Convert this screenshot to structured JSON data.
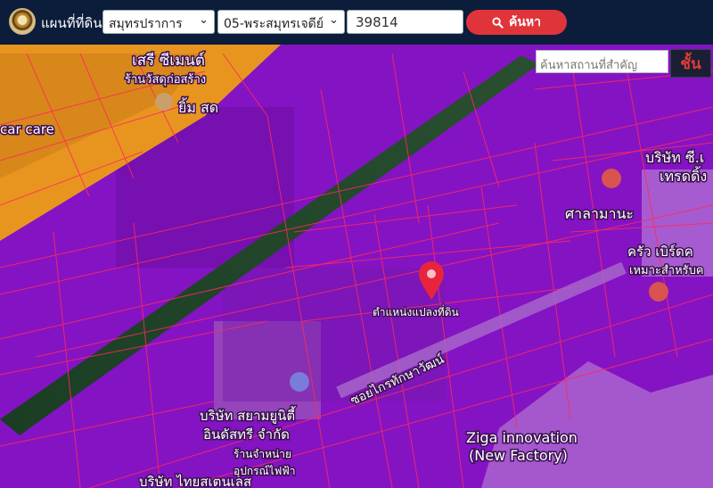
{
  "header": {
    "brand": "แผนที่ที่ดิน",
    "province_select": "สมุทรปราการ",
    "district_select": "05-พระสมุทรเจดีย์",
    "parcel_number": "39814",
    "search_button": "ค้นหา"
  },
  "map": {
    "place_search_placeholder": "ค้นหาสถานที่สำคัญ",
    "layer_button": "ชั้น",
    "marker_label": "ตำแหน่งแปลงที่ดิน",
    "labels": {
      "shop_top": "เสรี ซีเมนต์",
      "shop_top_sub": "ร้านวัสดุก่อสร้าง",
      "car_care": "car care",
      "yim_sod": "ยิ้ม สด",
      "company_tr": "บริษัท ซี.เ",
      "company_tr_sub": "เทรดดิ้ง",
      "sala": "ศาลามานะ",
      "krua": "ครัว เบิร์ดค",
      "krua_sub": "เหมาะสำหรับค",
      "road": "ซอยไกรทักษาวัฒน์",
      "siam_company": "บริษัท สยามยูนิตี้",
      "siam_company2": "อินดัสทรี จำกัด",
      "siam_sub1": "ร้านจำหน่าย",
      "siam_sub2": "อุปกรณ์ไฟฟ้า",
      "ziga": "Ziga innovation",
      "ziga2": "(New Factory)",
      "bottom_company": "บริษัท ไทยสเตนเลส"
    },
    "colors": {
      "zone_purple": "#8a14c8",
      "zone_orange": "#e8951e",
      "parcel_line": "#ff2a55",
      "marker": "#e8243c"
    }
  }
}
